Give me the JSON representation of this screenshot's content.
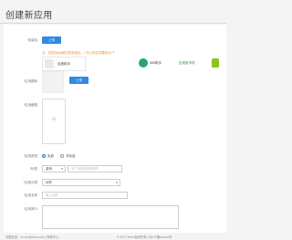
{
  "page": {
    "title": "创建新应用"
  },
  "form": {
    "publish_label": "安装包:",
    "upload_button": "上传",
    "hint": "注：仅支持Apk格式的安装包，一次上传文件限制为1个",
    "cards": [
      {
        "name": "百度助手"
      },
      {
        "name": "360助手"
      },
      {
        "name": "应用宝市场"
      }
    ],
    "icon_label": "*应用图标:",
    "icon_button": "上传",
    "screenshot_label": "*应用截图:",
    "upload_plus": "+",
    "type_label": "*应用类型:",
    "type_options": [
      {
        "label": "免费",
        "checked": true
      },
      {
        "label": "非免费",
        "checked": false
      }
    ],
    "tag_label": "*标签:",
    "tag_select": "游戏",
    "tag_placeholder": "多个标签用逗号隔开",
    "category_label": "*应用分类:",
    "category_select": "动作",
    "name_label": "*应用名称:",
    "name_placeholder": "输入名称",
    "desc_label": "*应用简介:"
  },
  "footer": {
    "left": "问题反馈：xx.xxx@xxxx.com | 帮助中心",
    "right": "© 2017 bxxk 版权所有 | 京ICP备xxxxxx号"
  },
  "colors": {
    "accent": "#2f8ae0",
    "hint": "#e58a1f",
    "title": "#444444"
  },
  "icons": [
    "plus-icon",
    "caret-down-icon",
    "android-icon"
  ]
}
